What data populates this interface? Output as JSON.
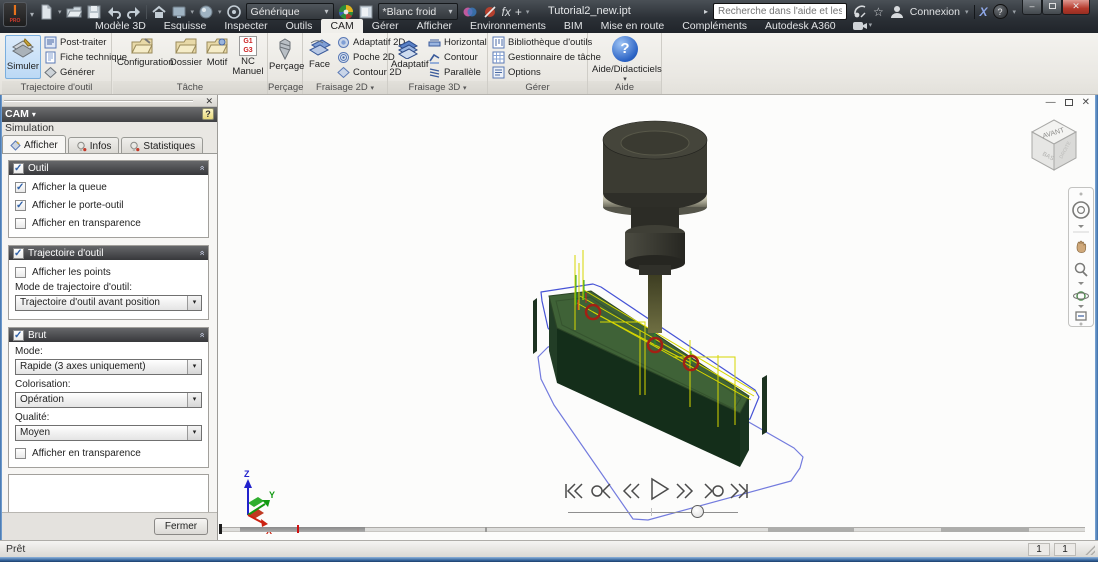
{
  "icons": {
    "chevron_down": "▾",
    "close": "✕",
    "check": "✓",
    "collapse_up": "»",
    "help": "?",
    "minimize": "–",
    "star": "☆",
    "plus": "+",
    "fx": "fx",
    "exchange_x": "X",
    "go_arrow": "▸"
  },
  "titlebar": {
    "logo": "I",
    "logo_sub": "PRO",
    "style_value": "Générique",
    "appearance_value": "*Blanc froid",
    "document_title": "Tutorial2_new.ipt",
    "search_placeholder": "Recherche dans l'aide et les com",
    "signin_label": "Connexion"
  },
  "ribbon": {
    "tabs": [
      "Modèle 3D",
      "Esquisse",
      "Inspecter",
      "Outils",
      "CAM",
      "Gérer",
      "Afficher",
      "Environnements",
      "BIM",
      "Mise en route",
      "Compléments",
      "Autodesk A360"
    ],
    "active_tab": "CAM",
    "toolpath": {
      "label": "Trajectoire d'outil",
      "big": "Simuler",
      "items": [
        "Post-traiter",
        "Fiche technique",
        "Générer"
      ]
    },
    "task": {
      "label": "Tâche",
      "items": [
        "Configuration",
        "Dossier",
        "Motif",
        "NC Manuel"
      ],
      "nc_lines": [
        "G1",
        "G3"
      ]
    },
    "drill": {
      "label": "Perçage",
      "big": "Perçage"
    },
    "mill2d": {
      "label": "Fraisage 2D",
      "big": "Face",
      "items": [
        "Adaptatif 2D",
        "Poche 2D",
        "Contour 2D"
      ]
    },
    "mill3d": {
      "label": "Fraisage 3D",
      "big": "Adaptatif",
      "items": [
        "Horizontal",
        "Contour",
        "Parallèle"
      ]
    },
    "manage": {
      "label": "Gérer",
      "items": [
        "Bibliothèque d'outils",
        "Gestionnaire de tâche",
        "Options"
      ]
    },
    "help": {
      "label": "Aide",
      "big": "Aide/Didacticiels"
    }
  },
  "sidepanel": {
    "title": "CAM",
    "subtitle": "Simulation",
    "tabs": [
      "Afficher",
      "Infos",
      "Statistiques"
    ],
    "outil": {
      "title": "Outil",
      "items": [
        "Afficher la queue",
        "Afficher le porte-outil",
        "Afficher en transparence"
      ],
      "checked": [
        true,
        true,
        false
      ]
    },
    "trajectoire": {
      "title": "Trajectoire d'outil",
      "points_item": "Afficher les points",
      "points_checked": false,
      "mode_label": "Mode de trajectoire d'outil:",
      "mode_value": "Trajectoire d'outil avant position"
    },
    "brut": {
      "title": "Brut",
      "mode_label": "Mode:",
      "mode_value": "Rapide (3 axes uniquement)",
      "color_label": "Colorisation:",
      "color_value": "Opération",
      "quality_label": "Qualité:",
      "quality_value": "Moyen",
      "transparency_item": "Afficher en transparence",
      "transparency_checked": false
    },
    "close_button": "Fermer"
  },
  "viewport": {
    "viewcube": {
      "top": "AVANT",
      "left": "BAS",
      "right": "DROITE"
    },
    "triad": {
      "x": "X",
      "y": "Y",
      "z": "Z"
    },
    "slider_position": 0.76
  },
  "statusbar": {
    "message": "Prêt",
    "fields": [
      "1",
      "1"
    ]
  },
  "colors": {
    "selection_blue": "#bcd9f5",
    "part_top": "#3f6237",
    "part_front": "#142e1a",
    "toolpath_yellow": "#d6d600",
    "contour_blue": "#4653d6",
    "drill_red": "#a32014",
    "timeline_red": "#d01010"
  }
}
